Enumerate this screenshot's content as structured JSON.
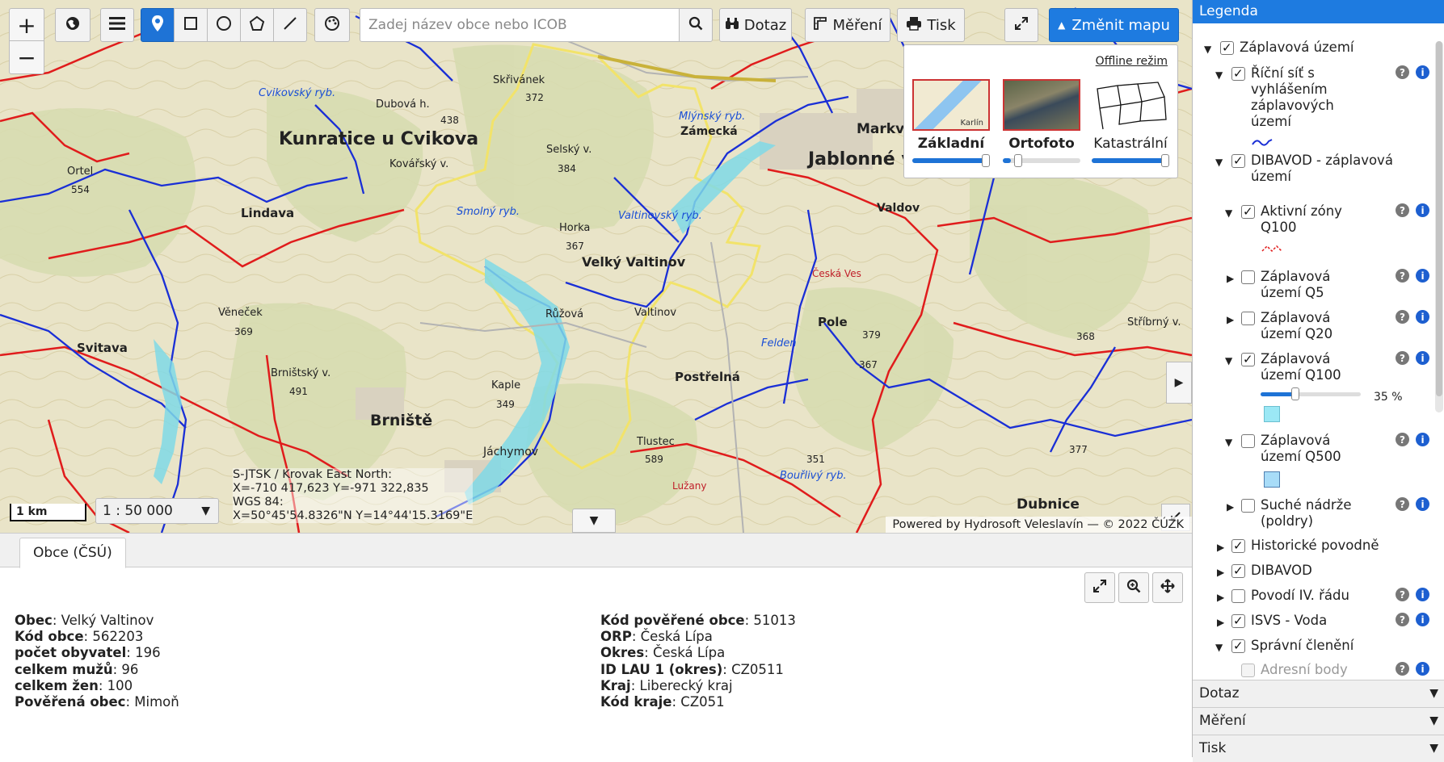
{
  "toolbar": {
    "search_placeholder": "Zadej název obce nebo ICOB",
    "query_label": "Dotaz",
    "measure_label": "Měření",
    "print_label": "Tisk",
    "change_map_label": "Změnit mapu",
    "zoom_in": "+",
    "zoom_out": "−"
  },
  "map_panel": {
    "offline_label": "Offline režim",
    "options": [
      {
        "name": "Základní",
        "opacity": 1.0,
        "thumb_label": "Karlín"
      },
      {
        "name": "Ortofoto",
        "opacity": 0.1
      },
      {
        "name": "Katastrální",
        "opacity": 1.0
      }
    ]
  },
  "map": {
    "scalebar_label": "1 km",
    "scale": "1 : 50 000",
    "coords": {
      "line1": "S-JTSK / Krovak East North:",
      "line2": "X=-710 417,623 Y=-971 322,835",
      "line3": "WGS 84:",
      "line4": "X=50°45'54.8326\"N Y=14°44'15.3169\"E"
    },
    "attribution_prefix": "Powered by",
    "attribution_link": "Hydrosoft Veleslavín",
    "attribution_suffix": "— © 2022 ČÚZK",
    "labels": [
      {
        "text": "Kunratice u Cvikova",
        "kind": "town"
      },
      {
        "text": "Lindava",
        "kind": "town"
      },
      {
        "text": "Svitava",
        "kind": "town"
      },
      {
        "text": "Brniště",
        "kind": "town"
      },
      {
        "text": "Velký Valtinov",
        "kind": "town"
      },
      {
        "text": "Jablonné v",
        "kind": "town"
      },
      {
        "text": "Postřelná",
        "kind": "town"
      },
      {
        "text": "Pole",
        "kind": "town"
      },
      {
        "text": "Dubnice",
        "kind": "town"
      },
      {
        "text": "Zámecká",
        "kind": "town"
      },
      {
        "text": "Markva",
        "kind": "town"
      },
      {
        "text": "Valdov",
        "kind": "town"
      },
      {
        "text": "Jáchymov",
        "kind": "town"
      },
      {
        "text": "Česká Ves",
        "kind": "town"
      },
      {
        "text": "Ortel",
        "kind": "peak"
      },
      {
        "text": "554",
        "kind": "peak"
      },
      {
        "text": "Selský v.",
        "kind": "peak"
      },
      {
        "text": "384",
        "kind": "peak"
      },
      {
        "text": "Horka",
        "kind": "peak"
      },
      {
        "text": "367",
        "kind": "peak"
      },
      {
        "text": "Kaple",
        "kind": "peak"
      },
      {
        "text": "349",
        "kind": "peak"
      },
      {
        "text": "Brništský v.",
        "kind": "peak"
      },
      {
        "text": "491",
        "kind": "peak"
      },
      {
        "text": "Věneček",
        "kind": "peak"
      },
      {
        "text": "369",
        "kind": "peak"
      },
      {
        "text": "Valtinov",
        "kind": "place"
      },
      {
        "text": "Růžová",
        "kind": "place"
      },
      {
        "text": "Tlustec",
        "kind": "peak"
      },
      {
        "text": "589",
        "kind": "peak"
      },
      {
        "text": "Dubová h.",
        "kind": "peak"
      },
      {
        "text": "438",
        "kind": "peak"
      },
      {
        "text": "Skřivánek",
        "kind": "peak"
      },
      {
        "text": "372",
        "kind": "peak"
      },
      {
        "text": "Kovářský v.",
        "kind": "peak"
      },
      {
        "text": "Stříbrný v.",
        "kind": "peak"
      },
      {
        "text": "368",
        "kind": "peak"
      },
      {
        "text": "377",
        "kind": "peak"
      },
      {
        "text": "379",
        "kind": "peak"
      },
      {
        "text": "367",
        "kind": "peak"
      },
      {
        "text": "351",
        "kind": "peak"
      },
      {
        "text": "Lužany",
        "kind": "place"
      },
      {
        "text": "Felden",
        "kind": "water"
      },
      {
        "text": "Smolný ryb.",
        "kind": "water"
      },
      {
        "text": "Valtinovský ryb.",
        "kind": "water"
      },
      {
        "text": "Mlýnský ryb.",
        "kind": "water"
      },
      {
        "text": "Cvikovský ryb.",
        "kind": "water"
      },
      {
        "text": "Bouřlivý ryb.",
        "kind": "water"
      }
    ]
  },
  "bottom": {
    "tab_label": "Obce (ČSÚ)",
    "left": [
      {
        "key": "Obec",
        "value": "Velký Valtinov"
      },
      {
        "key": "Kód obce",
        "value": "562203"
      },
      {
        "key": "počet obyvatel",
        "value": "196"
      },
      {
        "key": "celkem mužů",
        "value": "96"
      },
      {
        "key": "celkem žen",
        "value": "100"
      },
      {
        "key": "Pověřená obec",
        "value": "Mimoň"
      }
    ],
    "right": [
      {
        "key": "Kód pověřené obce",
        "value": "51013"
      },
      {
        "key": "ORP",
        "value": "Česká Lípa"
      },
      {
        "key": "Okres",
        "value": "Česká Lípa"
      },
      {
        "key": "ID LAU 1 (okres)",
        "value": "CZ0511"
      },
      {
        "key": "Kraj",
        "value": "Liberecký kraj"
      },
      {
        "key": "Kód kraje",
        "value": "CZ051"
      }
    ]
  },
  "legend": {
    "title": "Legenda",
    "items": [
      {
        "label": "Záplavová území",
        "checked": true,
        "expanded": true
      },
      {
        "label": "Říční síť s vyhlášením záplavových území",
        "checked": true,
        "expanded": true
      },
      {
        "label": "DIBAVOD - záplavová území",
        "checked": true,
        "expanded": true
      },
      {
        "label": "Aktivní zóny Q100",
        "checked": true,
        "expanded": true
      },
      {
        "label": "Záplavová území Q5",
        "checked": false,
        "expanded": false
      },
      {
        "label": "Záplavová území Q20",
        "checked": false,
        "expanded": false
      },
      {
        "label": "Záplavová území Q100",
        "checked": true,
        "expanded": true
      },
      {
        "label": "Záplavová území Q500",
        "checked": false,
        "expanded": true
      },
      {
        "label": "Suché nádrže (poldry)",
        "checked": false,
        "expanded": false
      },
      {
        "label": "Historické povodně",
        "checked": true,
        "expanded": false
      },
      {
        "label": "DIBAVOD",
        "checked": true,
        "expanded": false
      },
      {
        "label": "Povodí IV. řádu",
        "checked": false,
        "expanded": false
      },
      {
        "label": "ISVS - Voda",
        "checked": true,
        "expanded": false
      },
      {
        "label": "Správní členění",
        "checked": true,
        "expanded": true
      },
      {
        "label": "Adresní body",
        "checked": false,
        "expanded": false
      }
    ],
    "q100_opacity_label": "35 %",
    "q100_opacity": 0.35,
    "sections": [
      "Dotaz",
      "Měření",
      "Tisk"
    ]
  },
  "colors": {
    "accent": "#1e7be0",
    "river": "#1a2fd6",
    "boundary": "#e01c1c",
    "municipality": "#f2e36a",
    "flood": "#7fd9e6"
  }
}
